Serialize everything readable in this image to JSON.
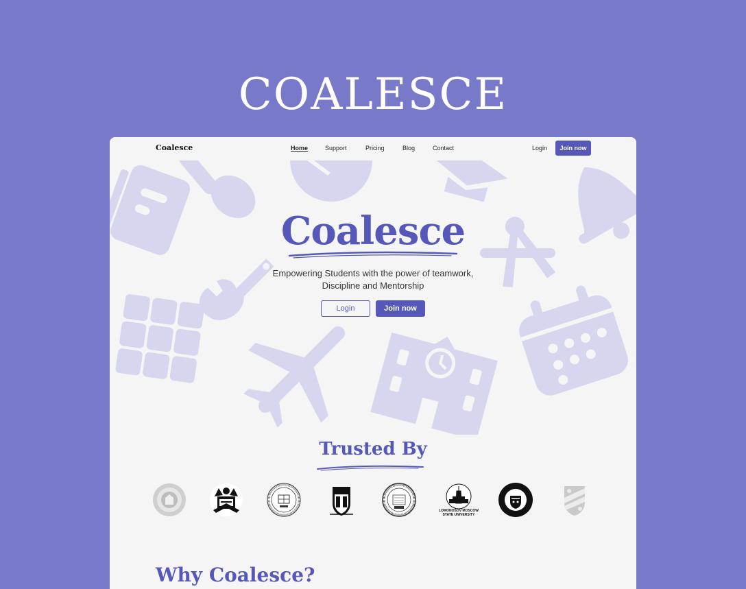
{
  "brand": {
    "wordmark": "COALESCE"
  },
  "nav": {
    "logo": "Coalesce",
    "links": [
      "Home",
      "Support",
      "Pricing",
      "Blog",
      "Contact"
    ],
    "active": "Home",
    "login_label": "Login",
    "join_label": "Join now"
  },
  "hero": {
    "title": "Coalesce",
    "subtitle_line1": "Empowering Students with the power of teamwork,",
    "subtitle_line2": "Discipline and Mentorship",
    "login_label": "Login",
    "join_label": "Join now"
  },
  "trusted": {
    "title": "Trusted By",
    "logos": [
      "boston-college-seal",
      "seoul-national-university-seal",
      "northwestern-university-seal",
      "duke-university-shield",
      "northeastern-university-seal",
      "lomonosov-moscow-state-university-logo",
      "university-of-pittsburgh-seal",
      "rice-university-shield"
    ],
    "lomonosov_text": "LOMONOSOV MOSCOW STATE UNIVERSITY"
  },
  "why": {
    "title": "Why Coalesce?"
  },
  "colors": {
    "background": "#7879c8",
    "accent": "#5558b9",
    "icon_tint": "#d6d7ee",
    "surface": "#f5f5f5"
  },
  "icons": [
    "notebook-icon",
    "paintbrush-icon",
    "clock-icon",
    "graduation-cap-icon",
    "bell-icon",
    "compass-icon",
    "wrench-icon",
    "grid-icon",
    "airplane-icon",
    "school-building-icon",
    "calendar-icon"
  ]
}
